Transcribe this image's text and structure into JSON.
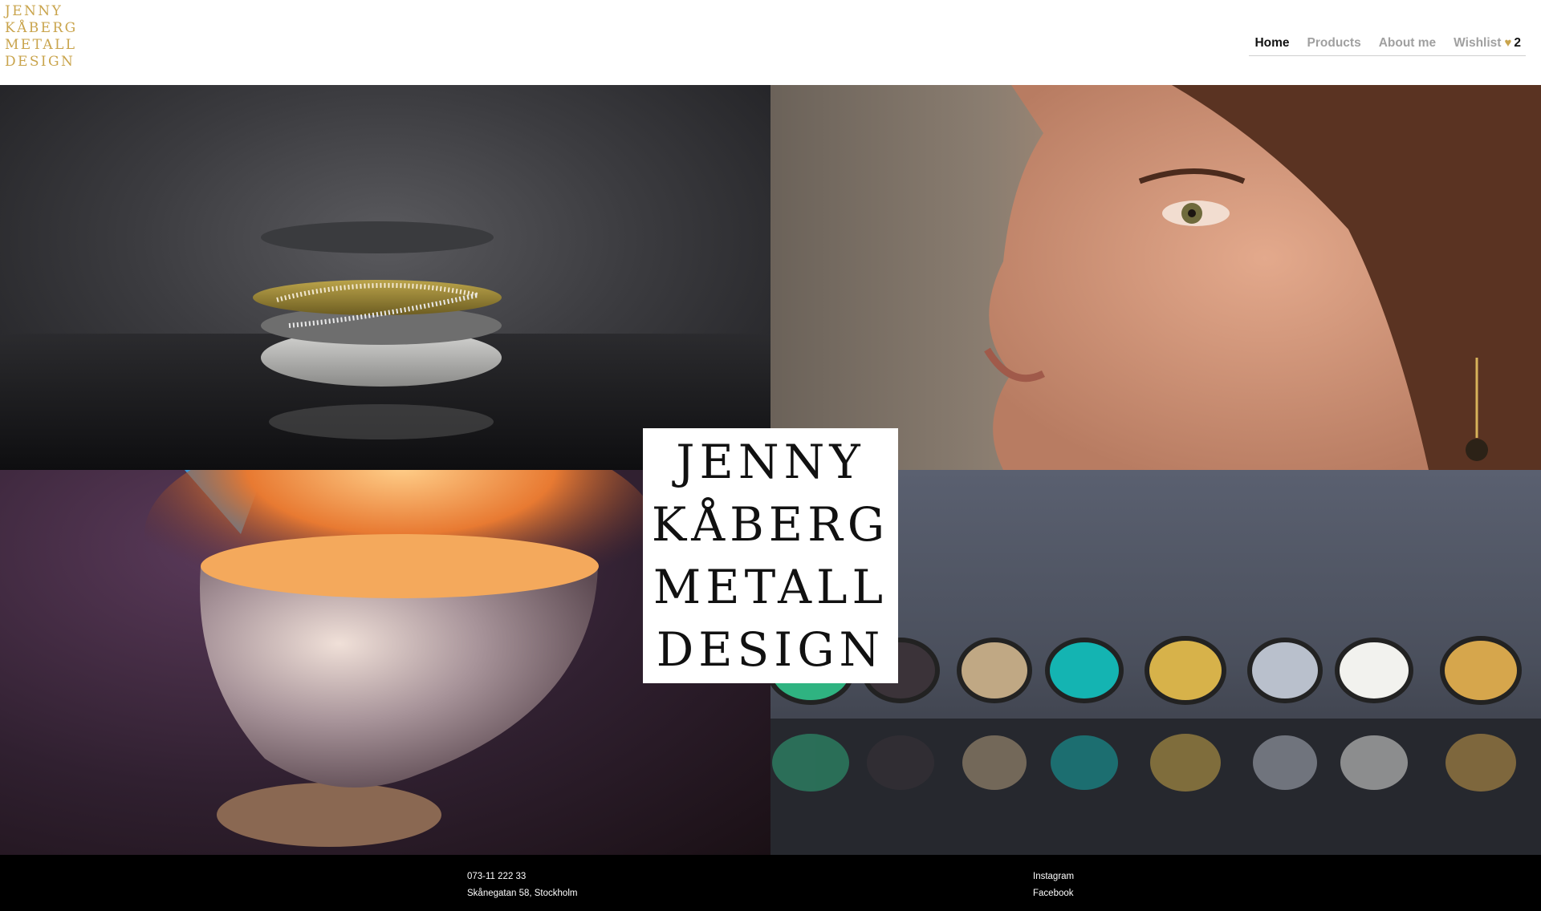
{
  "brand": {
    "logo_lines": [
      "JENNY",
      "KÅBERG",
      "METALL",
      "DESIGN"
    ],
    "accent_color": "#c9a44c"
  },
  "nav": {
    "items": [
      {
        "label": "Home",
        "active": true
      },
      {
        "label": "Products",
        "active": false
      },
      {
        "label": "About me",
        "active": false
      }
    ],
    "wishlist_label": "Wishlist",
    "wishlist_icon": "heart-icon",
    "wishlist_count": "2"
  },
  "hero": {
    "logo_lines": [
      "JENNY",
      "KÅBERG",
      "METALL",
      "DESIGN"
    ],
    "tiles": [
      "stacked-rings-photo",
      "woman-earring-photo",
      "torch-bowl-photo",
      "gemstone-rings-photo"
    ]
  },
  "footer": {
    "phone": "073-11 222 33",
    "address": "Skånegatan 58, Stockholm",
    "links": [
      "Instagram",
      "Facebook"
    ]
  }
}
